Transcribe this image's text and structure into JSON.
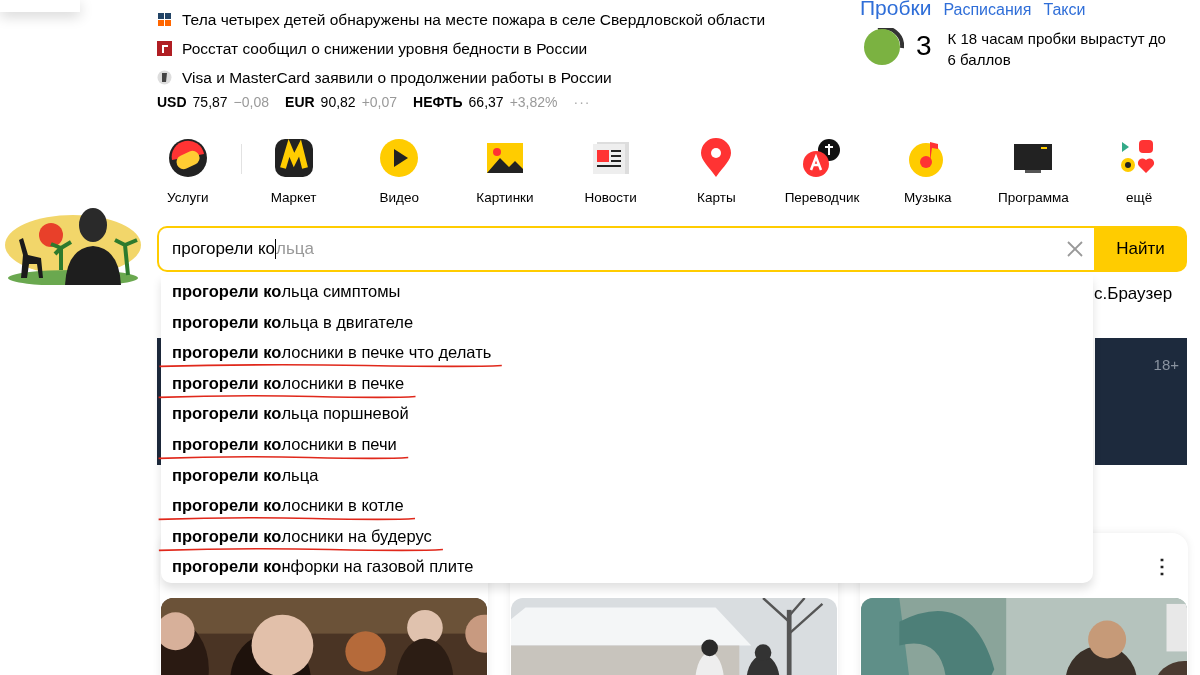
{
  "news": [
    {
      "kind": "rg",
      "text": "Тела четырех детей обнаружены на месте пожара в селе Свердловской области"
    },
    {
      "kind": "g",
      "text": "Росстат сообщил о снижении уровня бедности в России"
    },
    {
      "kind": "b",
      "text": "Visa и MasterCard заявили о продолжении работы в России"
    }
  ],
  "rates": [
    {
      "name": "USD",
      "value": "75,87",
      "change": "−0,08"
    },
    {
      "name": "EUR",
      "value": "90,82",
      "change": "+0,07"
    },
    {
      "name": "НЕФТЬ",
      "value": "66,37",
      "change": "+3,82%"
    }
  ],
  "rates_more": "···",
  "traffic": {
    "links": [
      {
        "label": "Пробки",
        "selected": true
      },
      {
        "label": "Расписания",
        "selected": false
      },
      {
        "label": "Такси",
        "selected": false
      }
    ],
    "score": "3",
    "color": "#7bb241",
    "forecast": "К 18 часам пробки вырастут до 6 баллов"
  },
  "services": [
    {
      "kind": "uslugi",
      "label": "Услуги"
    },
    {
      "kind": "market",
      "label": "Маркет"
    },
    {
      "kind": "video",
      "label": "Видео"
    },
    {
      "kind": "images",
      "label": "Картинки"
    },
    {
      "kind": "news",
      "label": "Новости"
    },
    {
      "kind": "maps",
      "label": "Карты"
    },
    {
      "kind": "translate",
      "label": "Переводчик"
    },
    {
      "kind": "music",
      "label": "Музыка"
    },
    {
      "kind": "tv",
      "label": "Программа"
    },
    {
      "kind": "more",
      "label": "ещё"
    }
  ],
  "search": {
    "value": "прогорели ко",
    "completion": "льца",
    "button": "Найти"
  },
  "suggestions": [
    {
      "text": "**прогорели ко**льца симптомы",
      "underlined": false
    },
    {
      "text": "**прогорели ко**льца в двигателе",
      "underlined": false
    },
    {
      "text": "**прогорели ко**лосники в печке что делать",
      "underlined": true
    },
    {
      "text": "**прогорели ко**лосники в печке",
      "underlined": true
    },
    {
      "text": "**прогорели ко**льца поршневой",
      "underlined": false
    },
    {
      "text": "**прогорели ко**лосники в печи",
      "underlined": true
    },
    {
      "text": "**прогорели ко**льца",
      "underlined": false
    },
    {
      "text": "**прогорели ко**лосники в котле",
      "underlined": true
    },
    {
      "text": "**прогорели ко**лосники на будерус",
      "underlined": true
    },
    {
      "text": "**прогорели ко**нфорки на газовой плите",
      "underlined": false
    }
  ],
  "promo": "с.Браузер",
  "ad_label": "18+",
  "cards": [
    {
      "kind": "picture"
    },
    {
      "kind": "picture"
    },
    {
      "kind": "picture",
      "menu": "⋮"
    }
  ]
}
